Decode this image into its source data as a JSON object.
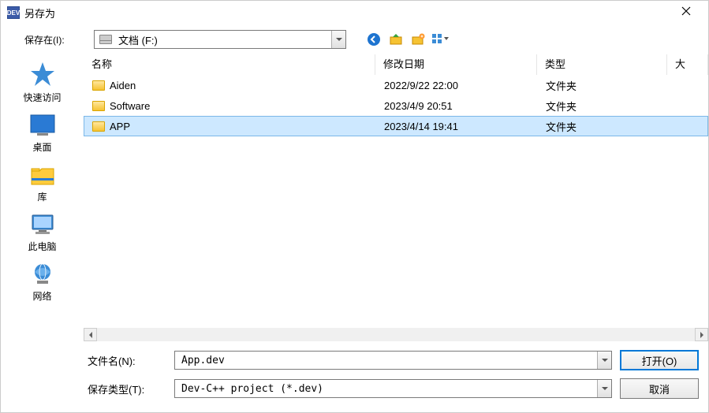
{
  "title": "另存为",
  "toolbar": {
    "save_in_label": "保存在(I):",
    "location_text": "文档 (F:)"
  },
  "places": [
    {
      "label": "快速访问"
    },
    {
      "label": "桌面"
    },
    {
      "label": "库"
    },
    {
      "label": "此电脑"
    },
    {
      "label": "网络"
    }
  ],
  "columns": {
    "name": "名称",
    "date": "修改日期",
    "type": "类型",
    "size": "大"
  },
  "files": [
    {
      "name": "Aiden",
      "date": "2022/9/22 22:00",
      "type": "文件夹"
    },
    {
      "name": "Software",
      "date": "2023/4/9 20:51",
      "type": "文件夹"
    },
    {
      "name": "APP",
      "date": "2023/4/14 19:41",
      "type": "文件夹"
    }
  ],
  "selected_index": 2,
  "bottom": {
    "filename_label": "文件名(N):",
    "filename_value": "App.dev",
    "filetype_label": "保存类型(T):",
    "filetype_value": "Dev-C++ project (*.dev)",
    "open_label": "打开(O)",
    "cancel_label": "取消"
  }
}
